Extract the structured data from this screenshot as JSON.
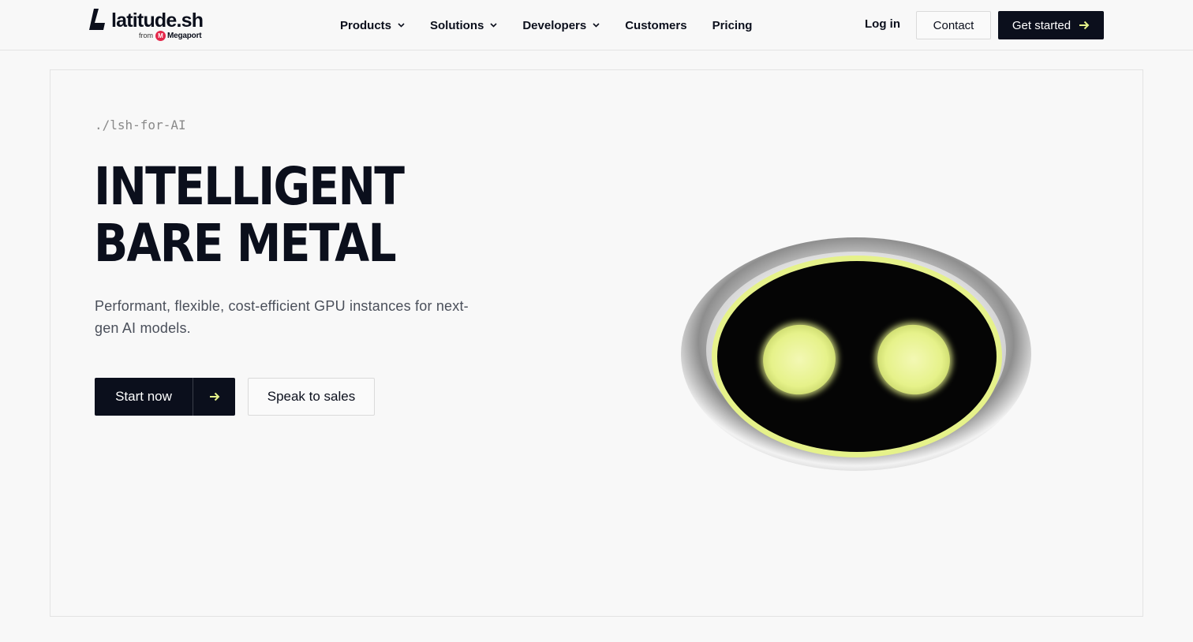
{
  "header": {
    "logo_text": "latitude.sh",
    "logo_from": "from",
    "logo_partner": "Megaport",
    "nav": [
      {
        "label": "Products",
        "dropdown": true
      },
      {
        "label": "Solutions",
        "dropdown": true
      },
      {
        "label": "Developers",
        "dropdown": true
      },
      {
        "label": "Customers",
        "dropdown": false
      },
      {
        "label": "Pricing",
        "dropdown": false
      }
    ],
    "login_label": "Log in",
    "contact_label": "Contact",
    "get_started_label": "Get started"
  },
  "hero": {
    "eyebrow": "./lsh-for-AI",
    "headline_line1": "INTELLIGENT",
    "headline_line2": "BARE METAL",
    "subtext": "Performant, flexible, cost-efficient GPU instances for next-gen AI models.",
    "start_label": "Start now",
    "sales_label": "Speak to sales"
  },
  "colors": {
    "brand_dark": "#0b0f1c",
    "accent_lime": "#e6f28a",
    "background": "#f8f8f8",
    "partner_red": "#e4274a"
  },
  "icons": [
    "latitude-logo-icon",
    "chevron-down-icon",
    "arrow-right-icon",
    "robot-face-illustration"
  ]
}
